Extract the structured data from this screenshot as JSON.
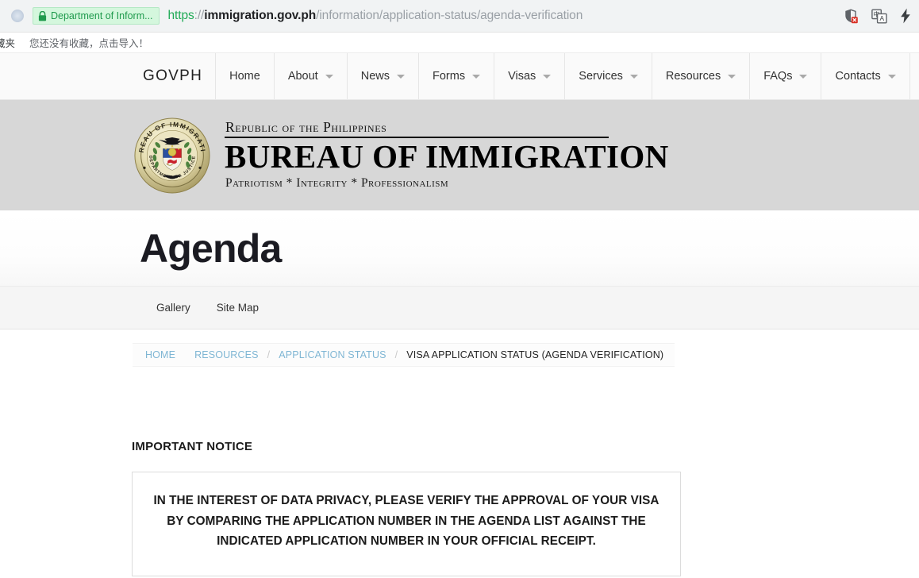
{
  "browser": {
    "security_chip_label": "Department of Inform...",
    "url": {
      "scheme": "https",
      "separator": "://",
      "host": "immigration.gov.ph",
      "path": "/information/application-status/agenda-verification"
    },
    "icons": [
      "shield-blocked-icon",
      "translate-icon",
      "lightning-icon"
    ]
  },
  "bookmarks": {
    "folder_label": "藏夹",
    "hint": "您还没有收藏，点击导入！"
  },
  "govph_nav": {
    "brand": "GOVPH",
    "items": [
      {
        "label": "Home",
        "has_caret": false
      },
      {
        "label": "About",
        "has_caret": true
      },
      {
        "label": "News",
        "has_caret": true
      },
      {
        "label": "Forms",
        "has_caret": true
      },
      {
        "label": "Visas",
        "has_caret": true
      },
      {
        "label": "Services",
        "has_caret": true
      },
      {
        "label": "Resources",
        "has_caret": true
      },
      {
        "label": "FAQs",
        "has_caret": true
      },
      {
        "label": "Contacts",
        "has_caret": true
      }
    ]
  },
  "agency_header": {
    "republic": "Republic of the Philippines",
    "bureau": "BUREAU OF IMMIGRATION",
    "motto": "Patriotism * Integrity * Professionalism",
    "seal": {
      "top_text": "BUREAU OF IMMIGRATION",
      "bottom_text": "DEPARTMENT OF JUSTICE"
    }
  },
  "page": {
    "title": "Agenda"
  },
  "subnav": {
    "items": [
      {
        "label": "Gallery"
      },
      {
        "label": "Site Map"
      }
    ]
  },
  "breadcrumb": {
    "home": "HOME",
    "resources": "RESOURCES",
    "application_status": "APPLICATION STATUS",
    "separator": "/",
    "current": "VISA APPLICATION STATUS (AGENDA VERIFICATION)"
  },
  "main": {
    "notice_heading": "IMPORTANT NOTICE",
    "notice_text": "IN THE INTEREST OF DATA PRIVACY, PLEASE VERIFY THE APPROVAL OF YOUR VISA BY COMPARING THE APPLICATION NUMBER IN THE AGENDA LIST AGAINST THE INDICATED APPLICATION NUMBER IN YOUR OFFICIAL RECEIPT."
  },
  "colors": {
    "secure_green": "#1f9a4d",
    "header_gray": "#d7d7d7",
    "crumb_link_blue": "#7fb6d4"
  }
}
